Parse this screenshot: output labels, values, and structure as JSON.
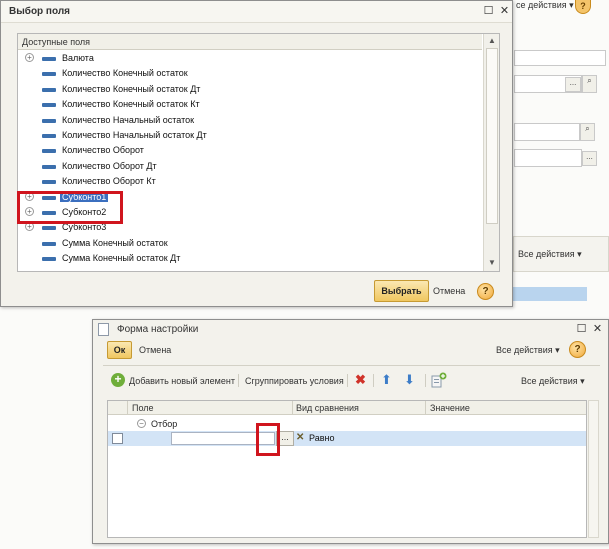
{
  "background": {
    "actions_label": "се действия ▾",
    "help_label": "?",
    "field_btn_label": "...",
    "search_btn_label": "🔍",
    "table_actions_label": "Все действия ▾"
  },
  "dialog1": {
    "title": "Выбор поля",
    "minimize": "☐",
    "close": "✕",
    "tree_header": "Доступные поля",
    "items": [
      {
        "label": "Валюта",
        "expandable": true
      },
      {
        "label": "Количество Конечный остаток",
        "expandable": false
      },
      {
        "label": "Количество Конечный остаток Дт",
        "expandable": false
      },
      {
        "label": "Количество Конечный остаток Кт",
        "expandable": false
      },
      {
        "label": "Количество Начальный остаток",
        "expandable": false
      },
      {
        "label": "Количество Начальный остаток Дт",
        "expandable": false
      },
      {
        "label": "Количество Оборот",
        "expandable": false
      },
      {
        "label": "Количество Оборот Дт",
        "expandable": false
      },
      {
        "label": "Количество Оборот Кт",
        "expandable": false
      },
      {
        "label": "Субконто1",
        "expandable": true,
        "selected": true
      },
      {
        "label": "Субконто2",
        "expandable": true
      },
      {
        "label": "Субконто3",
        "expandable": true
      },
      {
        "label": "Сумма Конечный остаток",
        "expandable": false
      },
      {
        "label": "Сумма Конечный остаток Дт",
        "expandable": false
      }
    ],
    "choose_button": "Выбрать",
    "cancel_button": "Отмена",
    "help": "?"
  },
  "dialog2": {
    "title": "Форма настройки",
    "close": "✕",
    "ok_button": "Ок",
    "cancel_link": "Отмена",
    "all_actions_top": "Все действия ▾",
    "help": "?",
    "toolbar": {
      "add_label": "Добавить новый элемент",
      "group_label": "Сгруппировать условия",
      "all_actions": "Все действия ▾"
    },
    "grid": {
      "headers": [
        "Поле",
        "Вид сравнения",
        "Значение"
      ],
      "group_row": "Отбор",
      "row": {
        "field": "",
        "dots": "...",
        "clear": "✕",
        "comparison": "Равно",
        "value": ""
      }
    }
  },
  "colors": {
    "highlight": "#d0151e",
    "selection": "#3b6fbf",
    "button_yellow": "#f0c760"
  }
}
